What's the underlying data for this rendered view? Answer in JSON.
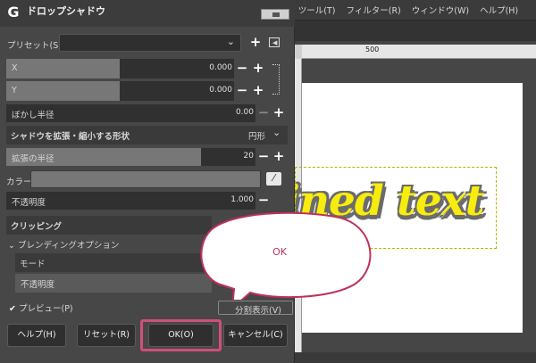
{
  "dialog": {
    "title": "ドロップシャドウ",
    "preset_label": "プリセット(S):",
    "preset_value": "",
    "x_label": "X",
    "x_value": "0.000",
    "y_label": "Y",
    "y_value": "0.000",
    "blur_label": "ぼかし半径",
    "blur_value": "0.00",
    "shape_label": "シャドウを拡張・縮小する形状",
    "shape_value": "円形",
    "grow_label": "拡張の半径",
    "grow_value": "20",
    "grow_fraction": 0.78,
    "color_label": "カラー",
    "shadow_color": "#777777",
    "opacity_label": "不透明度",
    "opacity_value": "1.000",
    "clipping_label": "クリッピング",
    "blend_options_label": "ブレンディングオプション",
    "mode_label": "モード",
    "blend_opacity_label": "不透明度",
    "preview_label": "プレビュー(P)",
    "split_view_label": "分割表示(V)",
    "buttons": {
      "help": "ヘルプ(H)",
      "reset": "リセット(R)",
      "ok": "OK(O)",
      "cancel": "キャンセル(C)"
    }
  },
  "menubar": [
    "ツール(T)",
    "フィルター(R)",
    "ウィンドウ(W)",
    "ヘルプ(H)"
  ],
  "ruler": {
    "mark": "500"
  },
  "canvas": {
    "text": "ined text",
    "text_color": "#f7ec0e",
    "shadow_color": "#6b6b6b"
  },
  "callout": {
    "text": "OK",
    "border_color": "#c0305a"
  },
  "highlight_color": "#cf4f7c"
}
